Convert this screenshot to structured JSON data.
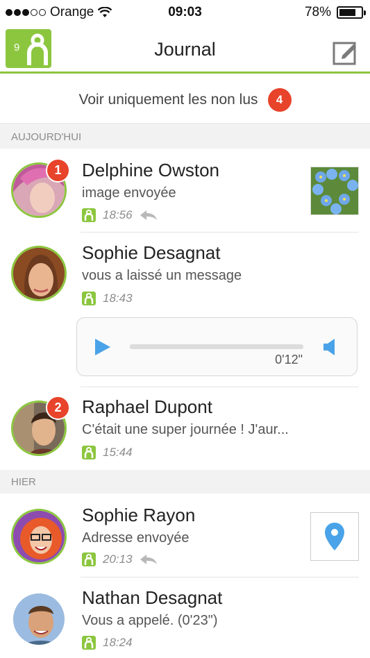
{
  "status_bar": {
    "carrier": "Orange",
    "time": "09:03",
    "battery": "78%",
    "battery_level": 0.78
  },
  "header": {
    "title": "Journal",
    "logo_count": "9",
    "compose_icon": "compose-icon"
  },
  "filter": {
    "label": "Voir uniquement les non lus",
    "unread_count": "4"
  },
  "sections": {
    "today": "AUJOURD'HUI",
    "yesterday": "HIER"
  },
  "conversations": [
    {
      "name": "Delphine Owston",
      "message": "image envoyée",
      "time": "18:56",
      "badge": "1",
      "replied": true,
      "attachment": "flower-photo"
    },
    {
      "name": "Sophie Desagnat",
      "message": "vous a laissé un message",
      "time": "18:43",
      "audio_duration": "0'12\""
    },
    {
      "name": "Raphael Dupont",
      "message": "C'était une super journée ! J'aur...",
      "time": "15:44",
      "badge": "2"
    },
    {
      "name": "Sophie Rayon",
      "message": "Adresse envoyée",
      "time": "20:13",
      "replied": true,
      "attachment": "map-pin-icon"
    },
    {
      "name": "Nathan Desagnat",
      "message": "Vous a appelé. (0'23\")",
      "time": "18:24"
    }
  ],
  "colors": {
    "accent": "#8cc63f",
    "badge": "#e8432b",
    "audio_blue": "#4aa3e8"
  }
}
